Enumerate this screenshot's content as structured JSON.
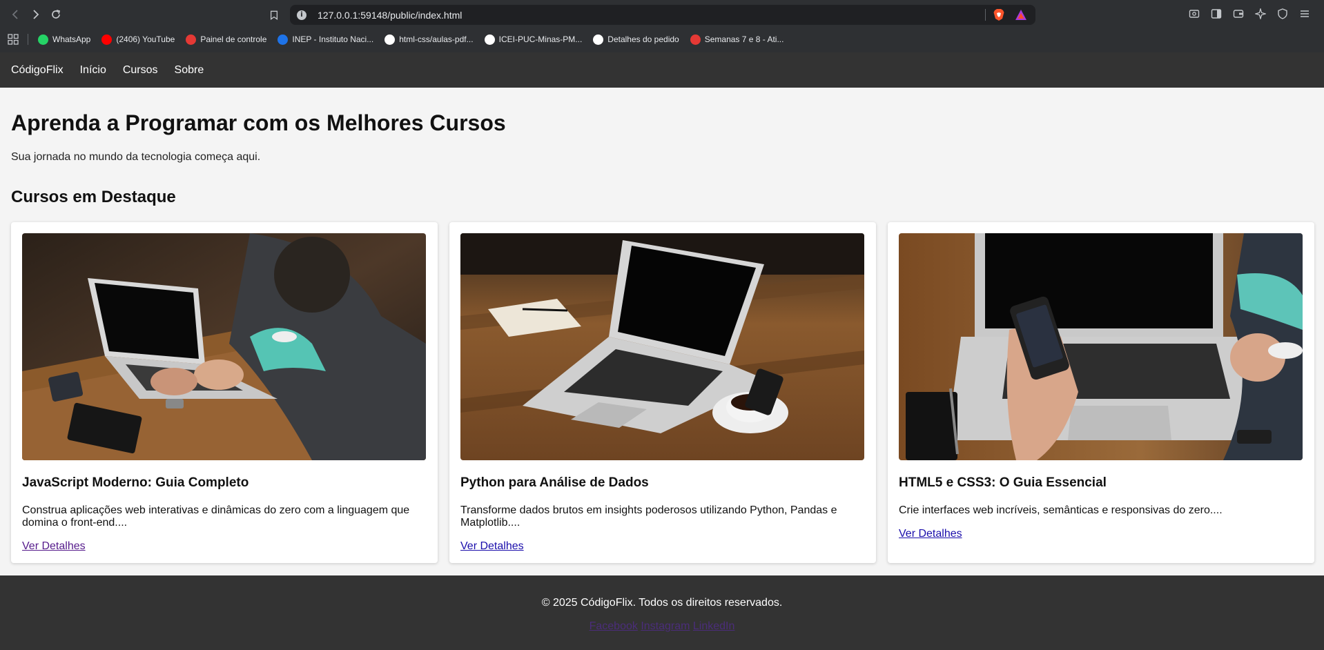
{
  "browser": {
    "url": "127.0.0.1:59148/public/index.html",
    "bookmarks": [
      {
        "label": "WhatsApp",
        "icon": "whatsapp-icon",
        "color": "#25d366"
      },
      {
        "label": "(2406) YouTube",
        "icon": "youtube-icon",
        "color": "#ff0000"
      },
      {
        "label": "Painel de controle",
        "icon": "dashboard-icon",
        "color": "#e53935"
      },
      {
        "label": "INEP - Instituto Naci...",
        "icon": "inep-icon",
        "color": "#1e73e8"
      },
      {
        "label": "html-css/aulas-pdf...",
        "icon": "github-icon",
        "color": "#ffffff"
      },
      {
        "label": "ICEI-PUC-Minas-PM...",
        "icon": "github-icon",
        "color": "#ffffff"
      },
      {
        "label": "Detalhes do pedido",
        "icon": "amazon-icon",
        "color": "#ffffff"
      },
      {
        "label": "Semanas 7 e 8 - Ati...",
        "icon": "canvas-icon",
        "color": "#e53935"
      }
    ]
  },
  "site": {
    "brand": "CódigoFlix",
    "nav": [
      "Início",
      "Cursos",
      "Sobre"
    ],
    "hero": {
      "title": "Aprenda a Programar com os Melhores Cursos",
      "subtitle": "Sua jornada no mundo da tecnologia começa aqui."
    },
    "featured_title": "Cursos em Destaque",
    "courses": [
      {
        "title": "JavaScript Moderno: Guia Completo",
        "description": "Construa aplicações web interativas e dinâmicas do zero com a linguagem que domina o front-end....",
        "link": "Ver Detalhes",
        "image": "laptop-man-typing-photo"
      },
      {
        "title": "Python para Análise de Dados",
        "description": "Transforme dados brutos em insights poderosos utilizando Python, Pandas e Matplotlib....",
        "link": "Ver Detalhes",
        "image": "laptop-coffee-notebook-photo"
      },
      {
        "title": "HTML5 e CSS3: O Guia Essencial",
        "description": "Crie interfaces web incríveis, semânticas e responsivas do zero....",
        "link": "Ver Detalhes",
        "image": "laptop-phone-hand-photo"
      }
    ],
    "footer": {
      "copyright": "© 2025 CódigoFlix. Todos os direitos reservados.",
      "social": [
        "Facebook",
        "Instagram",
        "LinkedIn"
      ]
    }
  },
  "colors": {
    "header_bg": "#333333",
    "page_bg": "#f4f4f4",
    "link": "#1a0dab",
    "link_visited": "#551a8b"
  }
}
